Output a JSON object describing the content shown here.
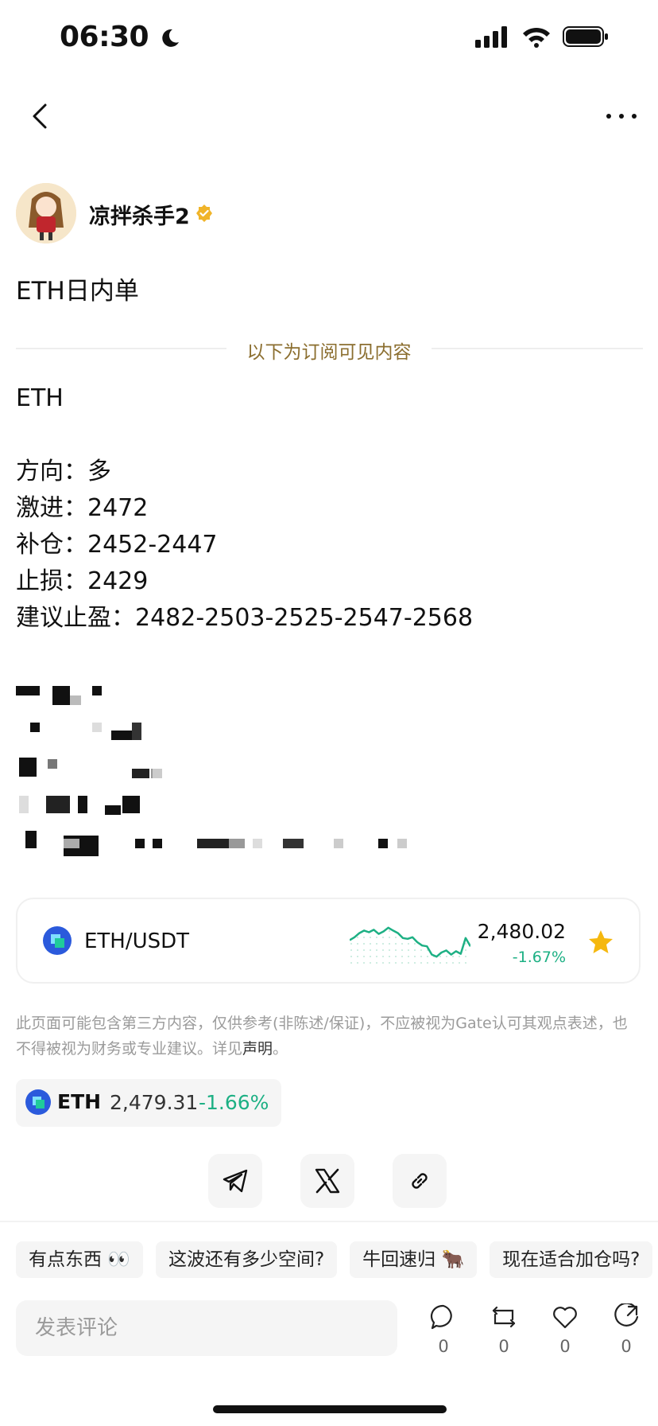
{
  "status_bar": {
    "time": "06:30"
  },
  "author": {
    "name": "凉拌杀手2"
  },
  "post": {
    "title": "ETH日内单",
    "subscriber_divider": "以下为订阅可见内容",
    "lines": [
      "ETH",
      "",
      "方向：多",
      "激进：2472",
      "补仓：2452-2447",
      "止损：2429",
      "建议止盈：2482-2503-2525-2547-2568"
    ]
  },
  "market_card": {
    "pair": "ETH/USDT",
    "price": "2,480.02",
    "change": "-1.67%",
    "sparkline": [
      0.55,
      0.62,
      0.72,
      0.78,
      0.74,
      0.8,
      0.7,
      0.76,
      0.85,
      0.78,
      0.72,
      0.6,
      0.58,
      0.62,
      0.5,
      0.42,
      0.4,
      0.2,
      0.15,
      0.25,
      0.3,
      0.2,
      0.28,
      0.22,
      0.6,
      0.4
    ],
    "accent_color": "#1db084"
  },
  "disclaimer": {
    "text": "此页面可能包含第三方内容，仅供参考(非陈述/保证)，不应被视为Gate认可其观点表述，也不得被视为财务或专业建议。详见",
    "link": "声明",
    "end": "。"
  },
  "ticker": {
    "symbol": "ETH",
    "price": "2,479.31",
    "change": "-1.66%"
  },
  "share": [
    "telegram-icon",
    "x-icon",
    "link-icon"
  ],
  "quick_replies": [
    "有点东西 👀",
    "这波还有多少空间?",
    "牛回速归 🐂",
    "现在适合加仓吗?"
  ],
  "comment": {
    "placeholder": "发表评论"
  },
  "actions": [
    {
      "name": "comment",
      "count": "0"
    },
    {
      "name": "repost",
      "count": "0"
    },
    {
      "name": "like",
      "count": "0"
    },
    {
      "name": "share",
      "count": "0"
    }
  ]
}
